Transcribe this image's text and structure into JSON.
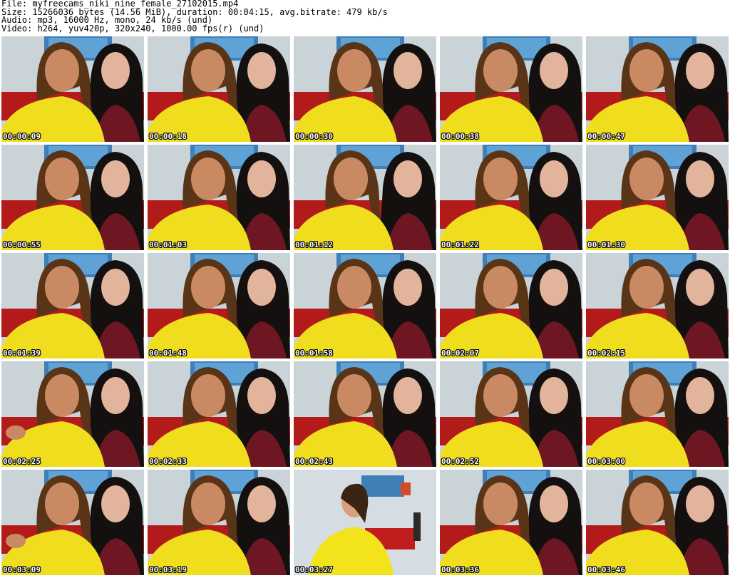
{
  "header": {
    "file": "File: myfreecams_niki_nine_female_27102015.mp4",
    "size": "Size: 15266036 bytes (14.56 MiB), duration: 00:04:15, avg.bitrate: 479 kb/s",
    "audio": "Audio: mp3, 16000 Hz, mono, 24 kb/s (und)",
    "video": "Video: h264, yuv420p, 320x240, 1000.00 fps(r) (und)"
  },
  "thumbnails": [
    {
      "time": "00:00:09",
      "variant": "a"
    },
    {
      "time": "00:00:18",
      "variant": "b"
    },
    {
      "time": "00:00:30",
      "variant": "b"
    },
    {
      "time": "00:00:38",
      "variant": "b"
    },
    {
      "time": "00:00:47",
      "variant": "b"
    },
    {
      "time": "00:00:55",
      "variant": "b"
    },
    {
      "time": "00:01:03",
      "variant": "b"
    },
    {
      "time": "00:01:12",
      "variant": "c"
    },
    {
      "time": "00:01:22",
      "variant": "b"
    },
    {
      "time": "00:01:30",
      "variant": "b"
    },
    {
      "time": "00:01:39",
      "variant": "b"
    },
    {
      "time": "00:01:48",
      "variant": "b"
    },
    {
      "time": "00:01:58",
      "variant": "b"
    },
    {
      "time": "00:02:07",
      "variant": "b"
    },
    {
      "time": "00:02:15",
      "variant": "b"
    },
    {
      "time": "00:02:25",
      "variant": "d"
    },
    {
      "time": "00:02:33",
      "variant": "b"
    },
    {
      "time": "00:02:43",
      "variant": "b"
    },
    {
      "time": "00:02:52",
      "variant": "b"
    },
    {
      "time": "00:03:00",
      "variant": "b"
    },
    {
      "time": "00:03:09",
      "variant": "d"
    },
    {
      "time": "00:03:19",
      "variant": "b"
    },
    {
      "time": "00:03:27",
      "variant": "e"
    },
    {
      "time": "00:03:36",
      "variant": "b"
    },
    {
      "time": "00:03:46",
      "variant": "b"
    }
  ]
}
